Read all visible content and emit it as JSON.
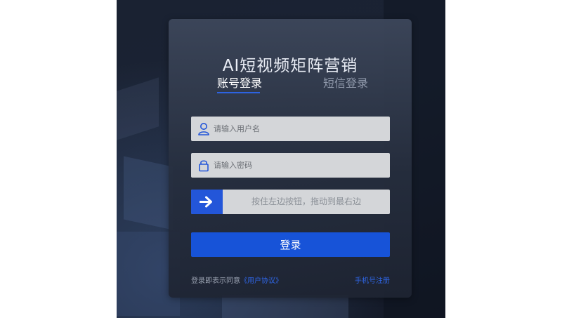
{
  "app": {
    "title": "AI短视频矩阵营销"
  },
  "tabs": [
    {
      "label": "账号登录",
      "active": true
    },
    {
      "label": "短信登录",
      "active": false
    }
  ],
  "form": {
    "username": {
      "placeholder": "请输入用户名",
      "value": "",
      "icon": "user-icon"
    },
    "password": {
      "placeholder": "请输入密码",
      "value": "",
      "icon": "lock-icon"
    },
    "slider": {
      "text": "按住左边按钮，拖动到最右边",
      "icon": "arrow-right-icon",
      "progress": 0
    },
    "submit_label": "登录"
  },
  "footer": {
    "agree_prefix": "登录即表示同意",
    "agreement_link": "《用户协议》",
    "register_link": "手机号注册"
  },
  "colors": {
    "accent": "#1753d8",
    "tab_active": "#ffffff",
    "tab_inactive": "#8f98aa",
    "link": "#2f66e6"
  }
}
